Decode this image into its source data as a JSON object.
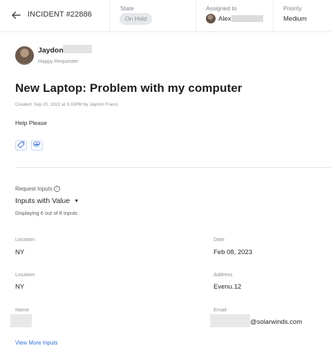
{
  "header": {
    "incident_label": "INCIDENT #22886",
    "state": {
      "label": "State",
      "value": "On Hold"
    },
    "assigned": {
      "label": "Assigned to",
      "value": "Alex"
    },
    "priority": {
      "label": "Priority",
      "value": "Medium"
    }
  },
  "requester": {
    "name": "Jaydon",
    "role": "Happy Requester"
  },
  "incident": {
    "title": "New Laptop: Problem with my computer",
    "created": "Created: Sep 20, 2022 at 5:32PM by Jaydon Franci.",
    "description": "Help Please"
  },
  "request_inputs": {
    "label": "Request Inputs",
    "info_glyph": "i",
    "selector": "Inputs with Value",
    "selector_caret": "▼",
    "count": "Displaying 6 out of 8 inputs",
    "fields": [
      {
        "label": "Location",
        "value": "NY"
      },
      {
        "label": "Date",
        "value": "Feb 08, 2023"
      },
      {
        "label": "Location",
        "value": "NY"
      },
      {
        "label": "Address",
        "value": "Evenu.12"
      },
      {
        "label": "Name",
        "value": ""
      },
      {
        "label": "Email",
        "value": "@solarwinds.com"
      }
    ],
    "view_more": "View More Inputs"
  },
  "icons": {
    "back": "arrow-left-icon",
    "tag": "tag-icon",
    "attach": "paperclip-icon",
    "info": "info-icon"
  },
  "colors": {
    "accent": "#2f6fd6",
    "state_pill_bg": "#e6e8ec"
  }
}
